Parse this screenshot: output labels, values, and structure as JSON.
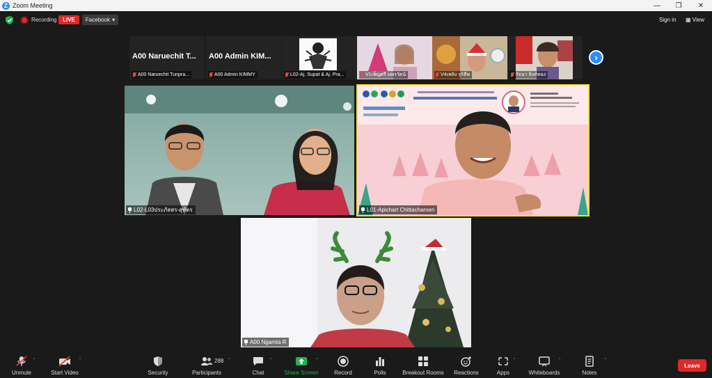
{
  "window": {
    "title": "Zoom Meeting"
  },
  "topbar": {
    "recording_label": "Recording",
    "live_label": "LIVE",
    "stream_target": "Facebook",
    "signin_label": "Sign in",
    "view_label": "View"
  },
  "thumbnails": [
    {
      "big_name": "A00  Naruechit T...",
      "label": "A00 Naruechit Tunpra..."
    },
    {
      "big_name": "A00  Admin  KIM...",
      "label": "A00 Admin KIMMY"
    },
    {
      "big_name": "",
      "label": "L02-Aj. Supat & Aj. Pra..."
    },
    {
      "big_name": "",
      "label": "V1เพ็ญศรี นพรวัตน์"
    },
    {
      "big_name": "",
      "label": "V4เพลิง รุจิธีพ"
    },
    {
      "big_name": "",
      "label": "รัจนา สิงห์ทอง"
    }
  ],
  "tiles": {
    "left": {
      "name": "L02-L03ประภัสสร-สุพัตร"
    },
    "right": {
      "name": "L01-Apichart Chittacharoen"
    },
    "bottom": {
      "name": "A00 Ngamta R"
    }
  },
  "toolbar": {
    "unmute": "Unmute",
    "start_video": "Start Video",
    "security": "Security",
    "participants": "Participants",
    "participants_count": "288",
    "chat": "Chat",
    "share_screen": "Share Screen",
    "record": "Record",
    "polls": "Polls",
    "breakout_rooms": "Breakout Rooms",
    "reactions": "Reactions",
    "apps": "Apps",
    "whiteboards": "Whiteboards",
    "notes": "Notes",
    "leave": "Leave"
  },
  "colors": {
    "accent": "#2d8cff",
    "danger": "#e02828",
    "share_green": "#23b14d"
  }
}
